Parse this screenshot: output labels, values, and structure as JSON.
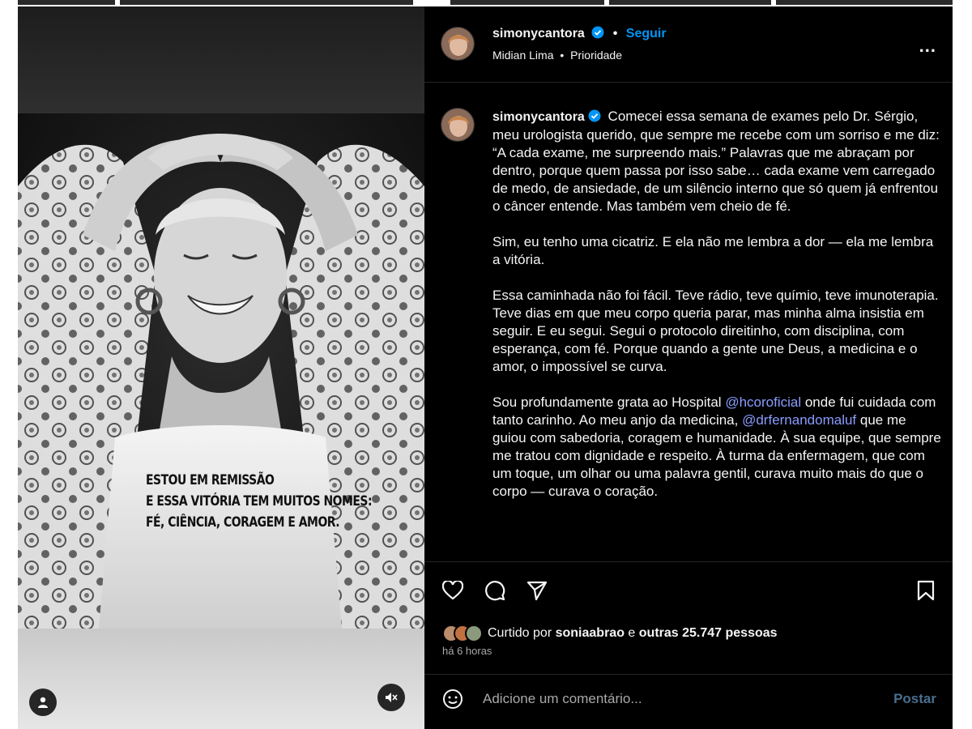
{
  "post": {
    "username": "simonycantora",
    "follow_label": "Seguir",
    "bullet": "•",
    "subtitle_left": "Midian Lima",
    "subtitle_right": "Prioridade",
    "more_label": "..."
  },
  "media": {
    "overlay_lines": [
      "ESTOU EM REMISSÃO",
      "E ESSA VITÓRIA TEM MUITOS NOMES:",
      "FÉ, CIÊNCIA, CORAGEM E AMOR."
    ]
  },
  "caption": {
    "username": "simonycantora",
    "p1": "Comecei essa semana de exames pelo Dr. Sérgio, meu urologista querido, que sempre me recebe com um sorriso e me diz: “A cada exame, me surpreendo mais.” Palavras que me abraçam por dentro, porque quem passa por isso sabe… cada exame vem carregado de medo, de ansiedade, de um silêncio interno que só quem já enfrentou o câncer entende. Mas também vem cheio de fé.",
    "p2": "Sim, eu tenho uma cicatriz. E ela não me lembra a dor — ela me lembra a vitória.",
    "p3": "Essa caminhada não foi fácil. Teve rádio, teve químio, teve imunoterapia. Teve dias em que meu corpo queria parar, mas minha alma insistia em seguir. E eu segui. Segui o protocolo direitinho, com disciplina, com esperança, com fé. Porque quando a gente une Deus, a medicina e o amor, o impossível se curva.",
    "p4_a": "Sou profundamente grata ao Hospital ",
    "p4_mention1": "@hcoroficial",
    "p4_b": " onde fui cuidada com tanto carinho. Ao meu anjo da medicina, ",
    "p4_mention2": "@drfernandomaluf",
    "p4_c": " que me guiou com sabedoria, coragem e humanidade. À sua equipe, que sempre me tratou com dignidade e respeito. À turma da enfermagem, que com um toque, um olhar ou uma palavra gentil, curava muito mais do que o corpo — curava o coração."
  },
  "engagement": {
    "liked_prefix": "Curtido por",
    "liked_user": "soniaabrao",
    "liked_and": "e",
    "liked_others": "outras 25.747 pessoas",
    "time": "há 6 horas"
  },
  "comment": {
    "placeholder": "Adicione um comentário...",
    "post_label": "Postar"
  },
  "colors": {
    "accent_blue": "#0095f6",
    "mention": "#8a9cff",
    "panel_bg": "#000000"
  }
}
